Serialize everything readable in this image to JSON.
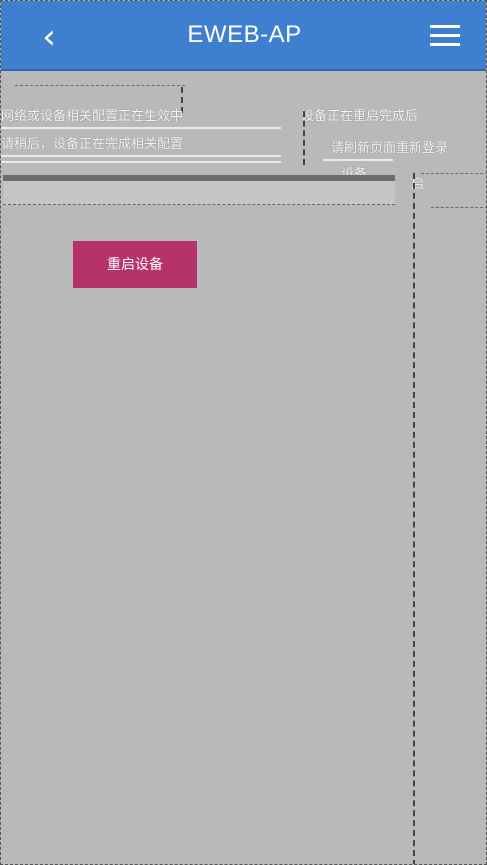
{
  "header": {
    "title": "EWEB-AP",
    "back_icon": "chevron-left-icon",
    "menu_icon": "hamburger-menu-icon"
  },
  "notice": {
    "line1": "网络或设备相关配置正在生效中",
    "line2": "请稍后，设备正在完成相关配置",
    "line3": "设备正在重启完成后",
    "line4": "请刷新页面重新登录",
    "line5": "设备",
    "line6": "启"
  },
  "actions": {
    "restart_label": "重启设备"
  },
  "colors": {
    "header_bg": "#3f7fcf",
    "restart_bg": "#b5336a",
    "page_bg": "#b9b9b9"
  }
}
